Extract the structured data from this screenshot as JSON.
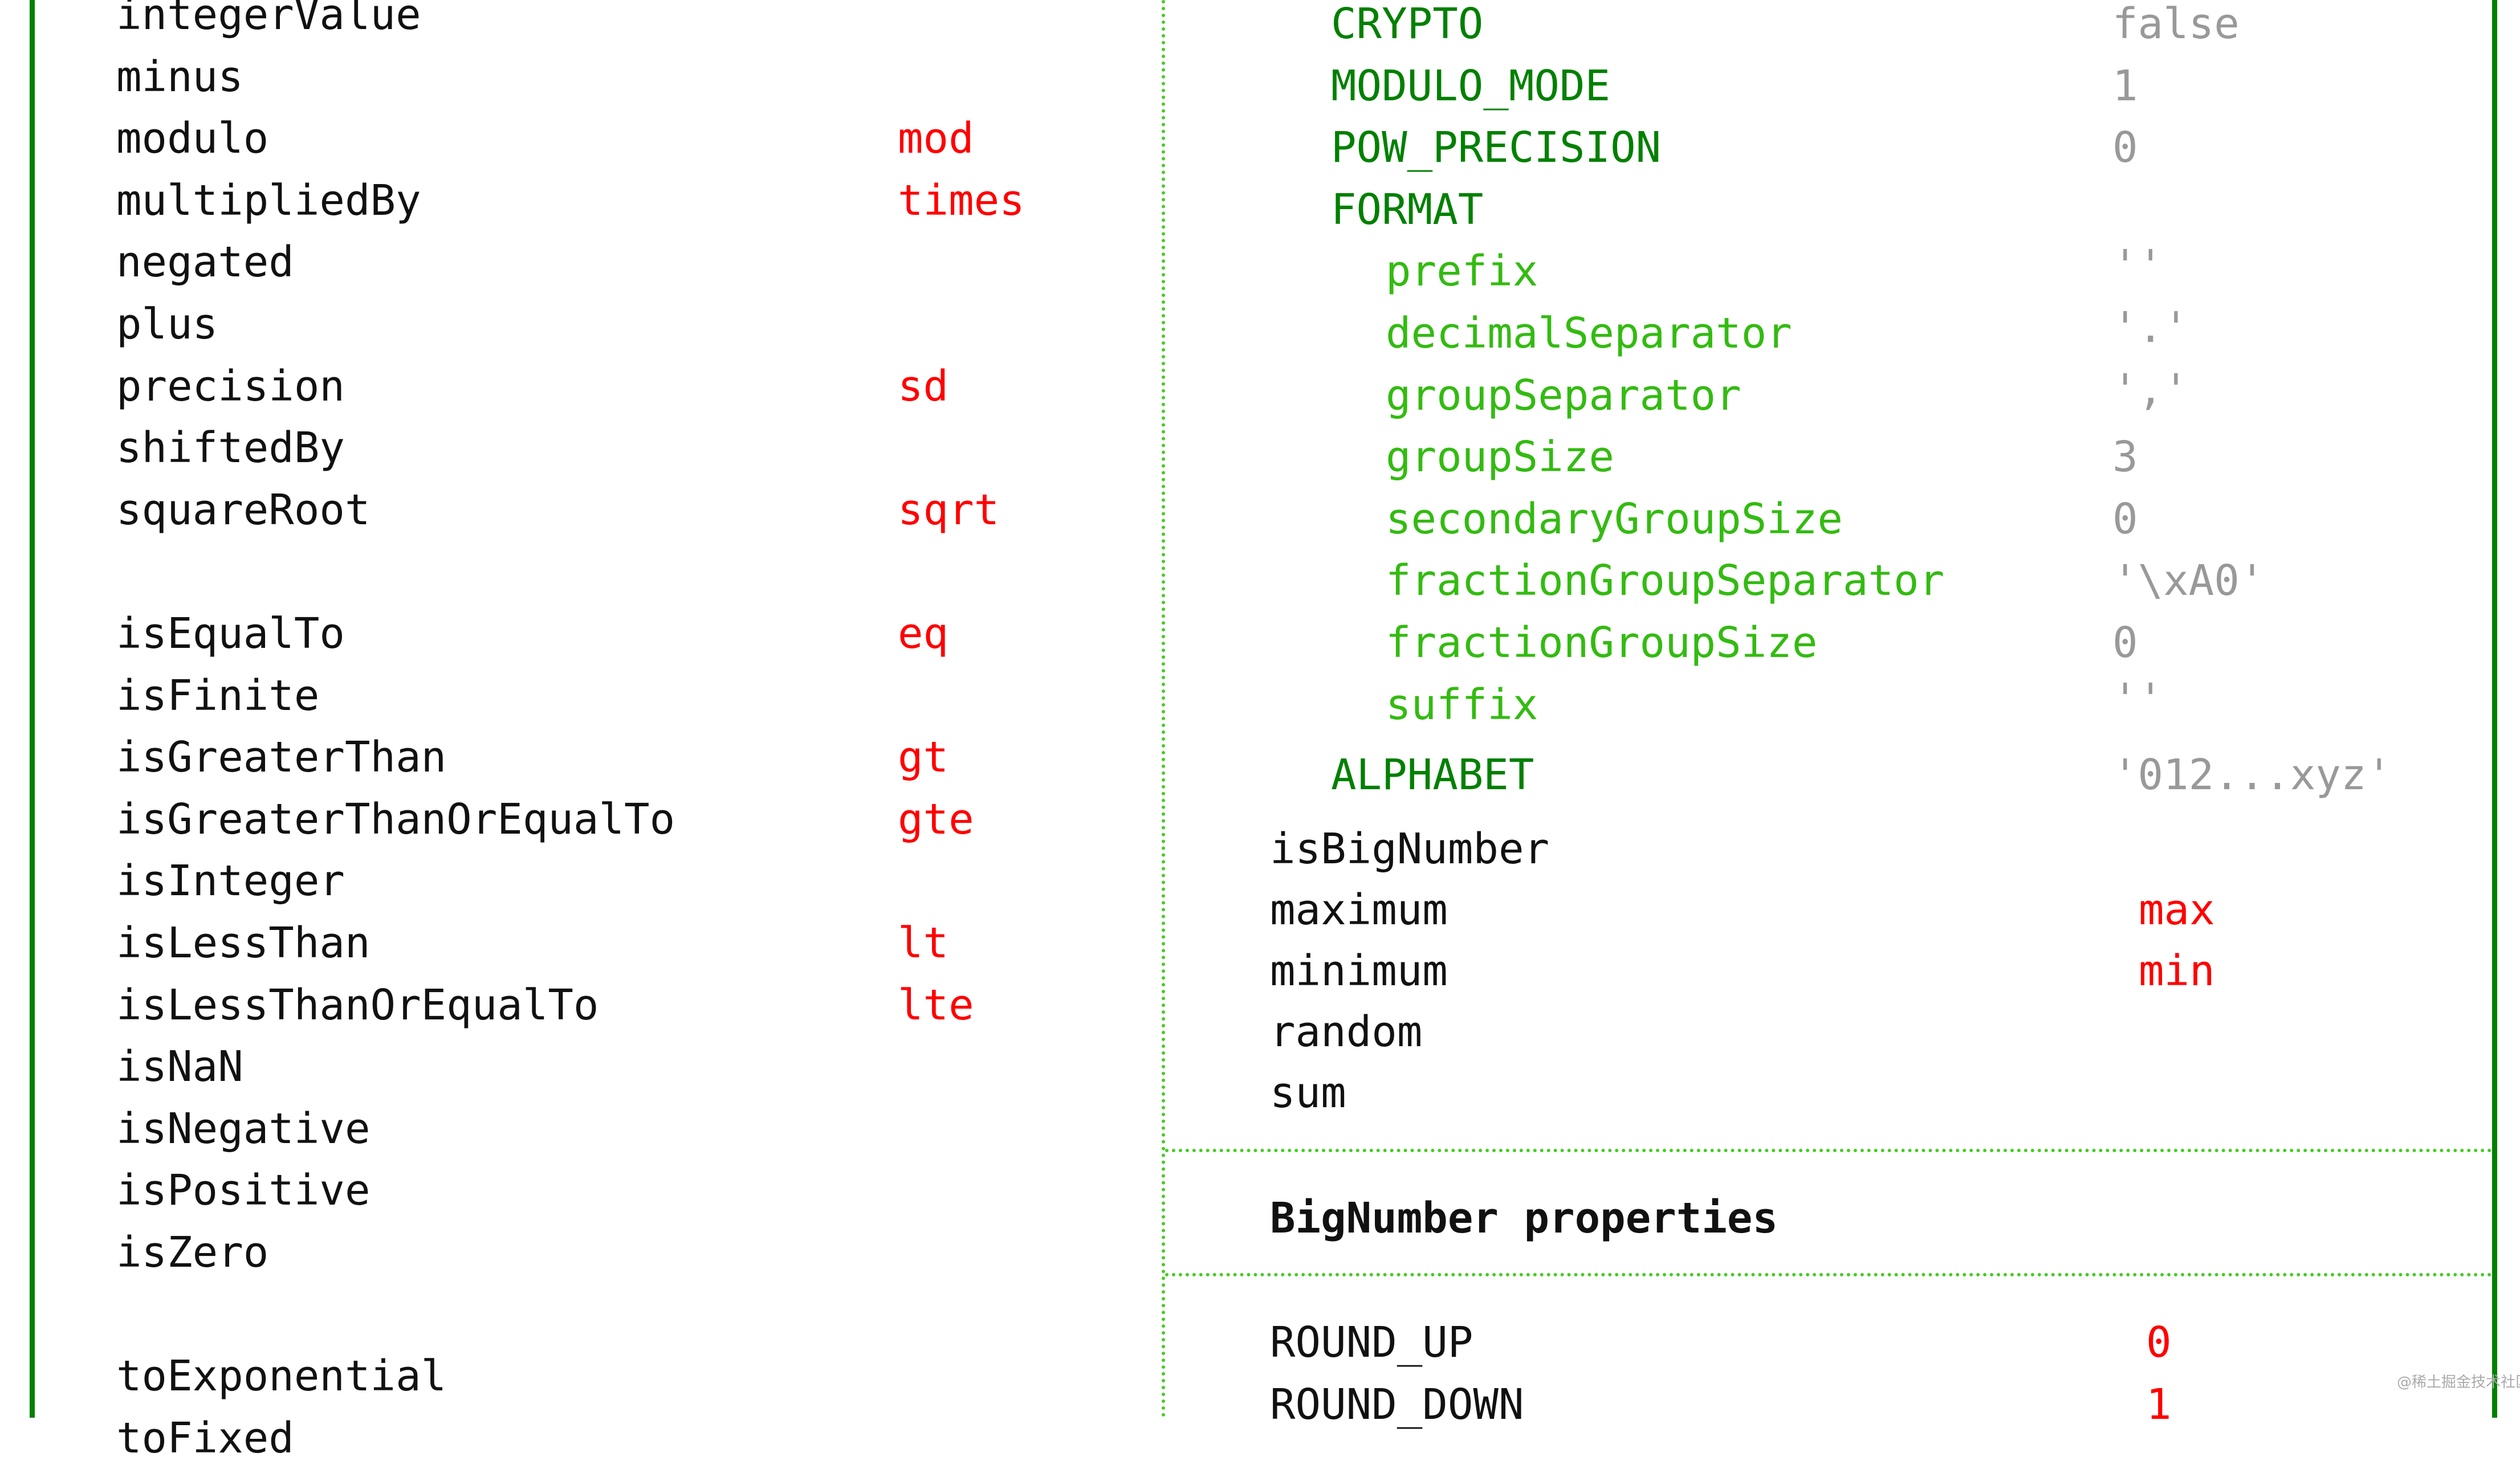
{
  "colors": {
    "border": "#008000",
    "divider": "#44cc22",
    "method": "#111111",
    "alias": "#ff0000",
    "config_key": "#008000",
    "format_key": "#33bb11",
    "config_value": "#999999"
  },
  "left_column": {
    "methods": [
      {
        "name": "integerValue",
        "alias": ""
      },
      {
        "name": "minus",
        "alias": ""
      },
      {
        "name": "modulo",
        "alias": "mod"
      },
      {
        "name": "multipliedBy",
        "alias": "times"
      },
      {
        "name": "negated",
        "alias": ""
      },
      {
        "name": "plus",
        "alias": ""
      },
      {
        "name": "precision",
        "alias": "sd"
      },
      {
        "name": "shiftedBy",
        "alias": ""
      },
      {
        "name": "squareRoot",
        "alias": "sqrt"
      },
      null,
      {
        "name": "isEqualTo",
        "alias": "eq"
      },
      {
        "name": "isFinite",
        "alias": ""
      },
      {
        "name": "isGreaterThan",
        "alias": "gt"
      },
      {
        "name": "isGreaterThanOrEqualTo",
        "alias": "gte"
      },
      {
        "name": "isInteger",
        "alias": ""
      },
      {
        "name": "isLessThan",
        "alias": "lt"
      },
      {
        "name": "isLessThanOrEqualTo",
        "alias": "lte"
      },
      {
        "name": "isNaN",
        "alias": ""
      },
      {
        "name": "isNegative",
        "alias": ""
      },
      {
        "name": "isPositive",
        "alias": ""
      },
      {
        "name": "isZero",
        "alias": ""
      },
      null,
      {
        "name": "toExponential",
        "alias": ""
      },
      {
        "name": "toFixed",
        "alias": ""
      }
    ]
  },
  "right_column": {
    "config": [
      {
        "key": "CRYPTO",
        "value": "false"
      },
      {
        "key": "MODULO_MODE",
        "value": "1"
      },
      {
        "key": "POW_PRECISION",
        "value": "0"
      },
      {
        "key": "FORMAT",
        "value": ""
      }
    ],
    "format": [
      {
        "key": "prefix",
        "value": "''"
      },
      {
        "key": "decimalSeparator",
        "value": "'.'"
      },
      {
        "key": "groupSeparator",
        "value": "','"
      },
      {
        "key": "groupSize",
        "value": "3"
      },
      {
        "key": "secondaryGroupSize",
        "value": "0"
      },
      {
        "key": "fractionGroupSeparator",
        "value": "'\\xA0'"
      },
      {
        "key": "fractionGroupSize",
        "value": "0"
      },
      {
        "key": "suffix",
        "value": "''"
      }
    ],
    "alphabet": {
      "key": "ALPHABET",
      "value": "'012...xyz'"
    },
    "static_methods": [
      {
        "name": "isBigNumber",
        "alias": ""
      },
      {
        "name": "maximum",
        "alias": "max"
      },
      {
        "name": "minimum",
        "alias": "min"
      },
      {
        "name": "random",
        "alias": ""
      },
      {
        "name": "sum",
        "alias": ""
      }
    ],
    "properties_heading": "BigNumber properties",
    "properties": [
      {
        "name": "ROUND_UP",
        "value": "0"
      },
      {
        "name": "ROUND_DOWN",
        "value": "1"
      }
    ]
  },
  "watermark": "@稀土掘金技术社区"
}
